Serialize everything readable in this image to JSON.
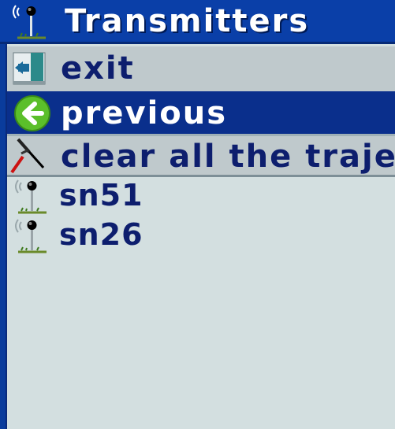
{
  "window": {
    "title": "Transmitters"
  },
  "menu": {
    "exit_label": "exit",
    "previous_label": "previous",
    "clear_label": "clear all the trajectories"
  },
  "transmitters": [
    {
      "label": "sn51"
    },
    {
      "label": "sn26"
    }
  ],
  "icons": {
    "title": "antenna-icon",
    "exit": "exit-door-icon",
    "previous": "back-arrow-icon",
    "clear": "broom-icon",
    "item": "antenna-icon"
  },
  "colors": {
    "title_bg": "#0a3fa8",
    "selected_bg": "#0a2f8c",
    "list_bg": "#d3dfe0",
    "menu_bg": "#bfc9cc",
    "text_dark": "#0d1e6e"
  }
}
